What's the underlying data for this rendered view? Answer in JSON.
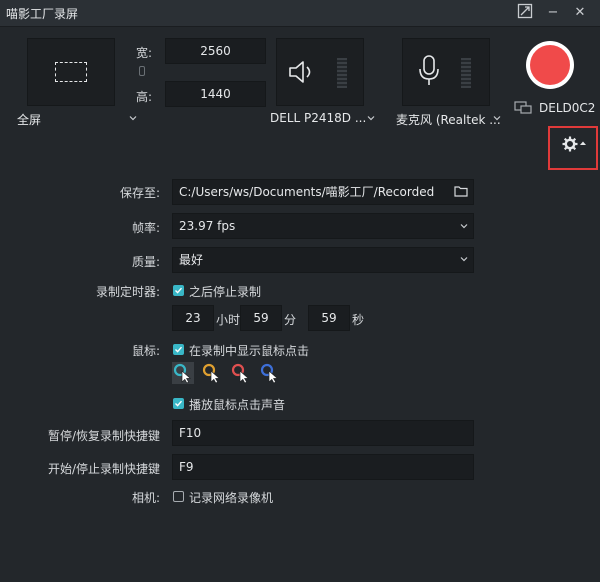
{
  "window": {
    "title": "喵影工厂录屏"
  },
  "screen": {
    "width_label": "宽:",
    "width_value": "2560",
    "height_label": "高:",
    "height_value": "1440",
    "mode": "全屏"
  },
  "devices": {
    "display": "DELL P2418D ...",
    "audio": "麦克风 (Realtek ...",
    "monitor_id": "DELD0C2"
  },
  "settings": {
    "save_label": "保存至:",
    "save_path": "C:/Users/ws/Documents/喵影工厂/Recorded",
    "fps_label": "帧率:",
    "fps_value": "23.97 fps",
    "quality_label": "质量:",
    "quality_value": "最好",
    "timer_label": "录制定时器:",
    "timer_checkbox": "之后停止录制",
    "timer_checked": true,
    "hours": "23",
    "hours_unit": "小时",
    "minutes": "59",
    "minutes_unit": "分",
    "seconds": "59",
    "seconds_unit": "秒",
    "mouse_label": "鼠标:",
    "mouse_checkbox": "在录制中显示鼠标点击",
    "mouse_checked": true,
    "cursor_colors": [
      "#39b7c7",
      "#e0a030",
      "#e05050",
      "#3d6fd8"
    ],
    "sound_checkbox": "播放鼠标点击声音",
    "sound_checked": true,
    "pause_hotkey_label": "暂停/恢复录制快捷键",
    "pause_hotkey": "F10",
    "start_hotkey_label": "开始/停止录制快捷键",
    "start_hotkey": "F9",
    "camera_label": "相机:",
    "camera_checkbox": "记录网络录像机",
    "camera_checked": false
  },
  "colors": {
    "accent": "#39b7c7",
    "record": "#f04a4a",
    "highlight_border": "#e03a3a"
  }
}
